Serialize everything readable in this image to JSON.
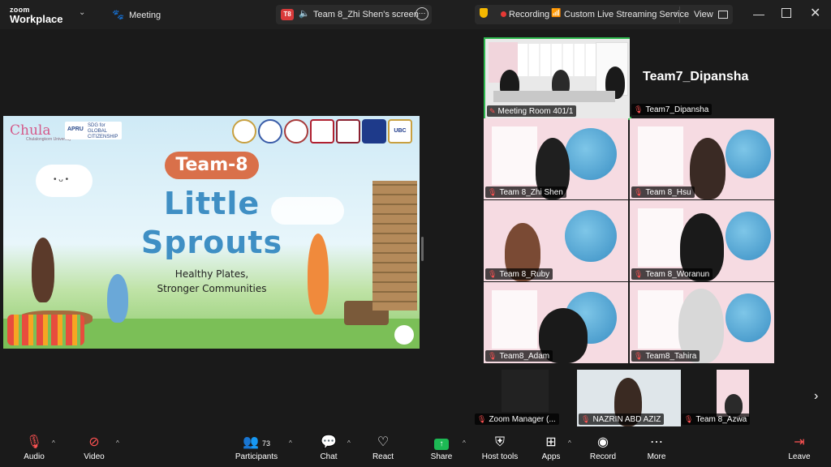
{
  "app": {
    "logo_top": "zoom",
    "logo_bottom": "Workplace",
    "meeting_label": "Meeting"
  },
  "share": {
    "badge": "T8",
    "label": "Team 8_Zhi Shen's screen"
  },
  "recording": {
    "label": "Recording",
    "streaming": "Custom Live Streaming Service",
    "view": "View"
  },
  "slide": {
    "logo_left": "Chula",
    "logo_left_sub": "Chulalongkorn University",
    "logo_apru": "APRU",
    "logo_sdg": "SDG for GLOBAL CITIZENSHIP",
    "badge": "Team-8",
    "title_1": "Little",
    "title_2": "Sprouts",
    "sub_1": "Healthy Plates,",
    "sub_2": "Stronger Communities",
    "logo_ubc": "UBC"
  },
  "participants": {
    "featured": {
      "room": "Meeting Room 401/1",
      "name": "Team7_Dipansha",
      "big_name": "Team7_Dipansha"
    },
    "grid": [
      {
        "name": "Team 8_Zhi Shen"
      },
      {
        "name": "Team 8_Hsu"
      },
      {
        "name": "Team 8_Ruby"
      },
      {
        "name": "Team 8_Woranun"
      },
      {
        "name": "Team8_Adam"
      },
      {
        "name": "Team8_Tahira"
      }
    ],
    "strip": [
      {
        "name": "Zoom Manager (..."
      },
      {
        "name": "NAZRIN ABD AZIZ"
      },
      {
        "name": "Team 8_Azwa"
      }
    ]
  },
  "toolbar": {
    "audio": "Audio",
    "video": "Video",
    "participants": "Participants",
    "participants_count": "73",
    "chat": "Chat",
    "react": "React",
    "share": "Share",
    "host_tools": "Host tools",
    "apps": "Apps",
    "record": "Record",
    "more": "More",
    "leave": "Leave"
  },
  "colors": {
    "accent_green": "#2fb84e",
    "mic_off": "#ff5252",
    "share_green": "#1db954"
  }
}
